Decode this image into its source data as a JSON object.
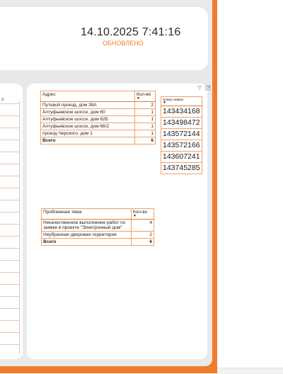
{
  "header": {
    "datetime": "14.10.2025 7:41:16",
    "status": "ОБНОВЛЕНО"
  },
  "left_panel": {
    "header_mark": "о"
  },
  "address_table": {
    "columns": [
      "Адрес",
      "Кол-во"
    ],
    "rows": [
      {
        "address": "Путевой проезд, дом 38А",
        "count": "2"
      },
      {
        "address": "Алтуфьевское шоссе, дом 60",
        "count": "1"
      },
      {
        "address": "Алтуфьевское шоссе, дом 62Б",
        "count": "1"
      },
      {
        "address": "Алтуфьевское шоссе, дом 66/2",
        "count": "1"
      },
      {
        "address": "проезд Черского, дом 1",
        "count": "1"
      }
    ],
    "total_label": "Всего",
    "total_value": "6"
  },
  "orders_table": {
    "header": "Номер заявки",
    "items": [
      "143434168",
      "143498472",
      "143572144",
      "143572166",
      "143607241",
      "143745285"
    ]
  },
  "theme_table": {
    "columns": [
      "Проблемная тема",
      "Кол-во"
    ],
    "rows": [
      {
        "theme": "Некачественное выполнение работ по заявке в проекте \"Электронный дом\"",
        "count": "4"
      },
      {
        "theme": "Неубранная дворовая территория",
        "count": "2"
      }
    ],
    "total_label": "Всего",
    "total_value": "6"
  },
  "icons": [
    "filter-icon",
    "focus-mode-icon",
    "sort-descending-icon"
  ],
  "colors": {
    "accent": "#f07b2a",
    "background": "#e9e9e9",
    "card": "#ffffff"
  }
}
